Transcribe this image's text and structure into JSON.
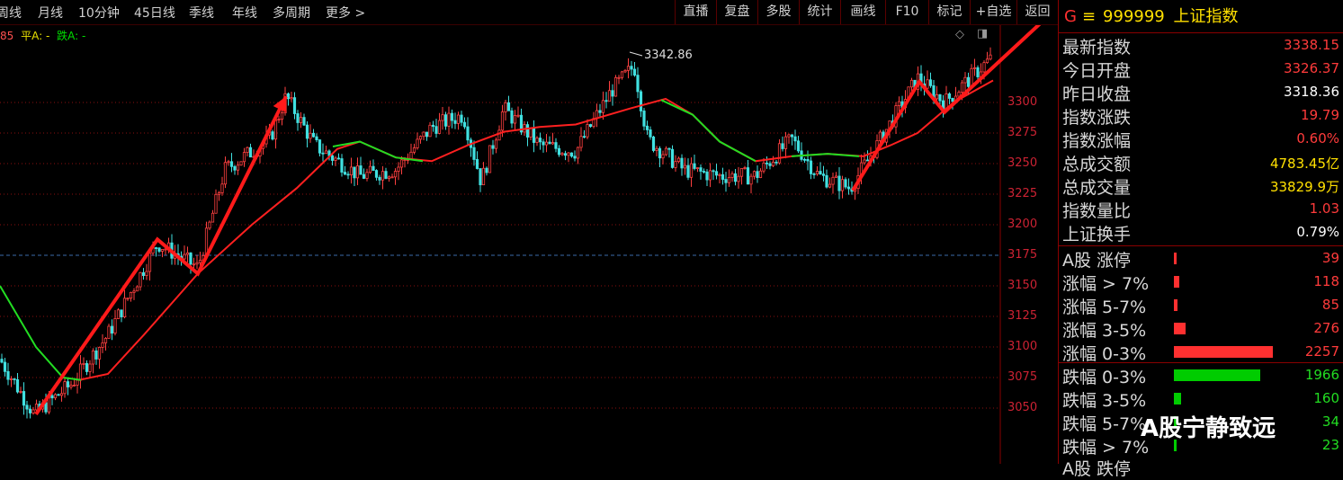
{
  "top_bar": {
    "period_tabs": [
      "周线",
      "月线",
      "10分钟",
      "45日线",
      "季线",
      "年线",
      "多周期",
      "更多 >"
    ],
    "tools": [
      "直播",
      "复盘",
      "多股",
      "统计",
      "画线",
      "F10",
      "标记",
      "+自选",
      "返回"
    ]
  },
  "legend": {
    "prefix": "85",
    "flat": "平A: -",
    "fall": "跌A: -"
  },
  "chart": {
    "peak_label": "3342.86",
    "y_ticks": [
      "3300",
      "3275",
      "3250",
      "3225",
      "3200",
      "3175",
      "3150",
      "3125",
      "3100",
      "3075",
      "3050"
    ]
  },
  "panel": {
    "title_marker": "G",
    "title_icon": "≡",
    "code": "999999",
    "name": "上证指数",
    "quote_rows": [
      {
        "label": "最新指数",
        "value": "3338.15",
        "color": "#ff3b3b"
      },
      {
        "label": "今日开盘",
        "value": "3326.37",
        "color": "#ff3b3b"
      },
      {
        "label": "昨日收盘",
        "value": "3318.36",
        "color": "#ffffff"
      },
      {
        "label": "指数涨跌",
        "value": "19.79",
        "color": "#ff3b3b"
      },
      {
        "label": "指数涨幅",
        "value": "0.60%",
        "color": "#ff3b3b"
      },
      {
        "label": "总成交额",
        "value": "4783.45亿",
        "color": "#ffe000"
      },
      {
        "label": "总成交量",
        "value": "33829.9万",
        "color": "#ffe000"
      },
      {
        "label": "指数量比",
        "value": "1.03",
        "color": "#ff3b3b"
      },
      {
        "label": "上证换手",
        "value": "0.79%",
        "color": "#ffffff"
      }
    ],
    "breadth_rows": [
      {
        "label": "A股 涨停",
        "value": "39",
        "color": "#ff3b3b",
        "bar_color": "#ff3030",
        "frac": 0.017
      },
      {
        "label": "涨幅 > 7%",
        "value": "118",
        "color": "#ff3b3b",
        "bar_color": "#ff3030",
        "frac": 0.052
      },
      {
        "label": "涨幅 5-7%",
        "value": "85",
        "color": "#ff3b3b",
        "bar_color": "#ff3030",
        "frac": 0.038
      },
      {
        "label": "涨幅 3-5%",
        "value": "276",
        "color": "#ff3b3b",
        "bar_color": "#ff3030",
        "frac": 0.122
      },
      {
        "label": "涨幅 0-3%",
        "value": "2257",
        "color": "#ff3b3b",
        "bar_color": "#ff3030",
        "frac": 1.0
      },
      {
        "label": "跌幅 0-3%",
        "value": "1966",
        "color": "#22dd22",
        "bar_color": "#00cc00",
        "frac": 0.871
      },
      {
        "label": "跌幅 3-5%",
        "value": "160",
        "color": "#22dd22",
        "bar_color": "#00cc00",
        "frac": 0.071
      },
      {
        "label": "跌幅 5-7%",
        "value": "34",
        "color": "#22dd22",
        "bar_color": "#00cc00",
        "frac": 0.015
      },
      {
        "label": "跌幅 > 7%",
        "value": "23",
        "color": "#22dd22",
        "bar_color": "#00cc00",
        "frac": 0.01
      }
    ],
    "cut_row_label": "A股 跌停"
  },
  "watermark": "A股宁静致远",
  "colors": {
    "up": "#ff3030",
    "down": "#00cc00",
    "accent": "#ffe000",
    "grid": "#8a1010"
  }
}
